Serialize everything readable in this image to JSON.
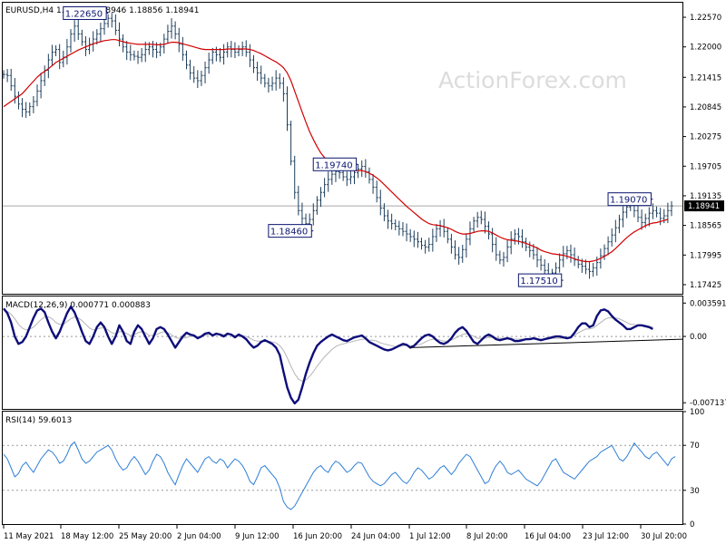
{
  "watermark": "ActionForex.com",
  "chart_data": [
    {
      "type": "line",
      "panel": "price",
      "title": "EURUSD,H4 1.18883 1.18946 1.18856 1.18941",
      "xlabel": "",
      "ylabel": "",
      "ylim": [
        1.1725,
        1.2285
      ],
      "y_ticks": [
        "1.22570",
        "1.22000",
        "1.21415",
        "1.20845",
        "1.20275",
        "1.19705",
        "1.19135",
        "1.18565",
        "1.17995",
        "1.17425"
      ],
      "current_price": "1.18941",
      "colors": {
        "price": "#1d3e5c",
        "ma": "#d20000",
        "current_line": "#a9a9a9"
      },
      "x_ticks": [
        "11 May 2021",
        "18 May 12:00",
        "25 May 20:00",
        "2 Jun 04:00",
        "9 Jun 12:00",
        "16 Jun 20:00",
        "24 Jun 04:00",
        "1 Jul 12:00",
        "8 Jul 20:00",
        "16 Jul 04:00",
        "23 Jul 12:00",
        "30 Jul 20:00"
      ],
      "annotations": [
        {
          "text": "1.22650",
          "x_index": 28,
          "y": 1.2265
        },
        {
          "text": "1.19740",
          "x_index": 95,
          "y": 1.1974
        },
        {
          "text": "1.18460",
          "x_index": 83,
          "y": 1.1846
        },
        {
          "text": "1.17510",
          "x_index": 150,
          "y": 1.1751
        },
        {
          "text": "1.19070",
          "x_index": 174,
          "y": 1.1907
        }
      ],
      "series": [
        {
          "name": "EURUSD",
          "values": [
            1.2147,
            1.2145,
            1.2125,
            1.2105,
            1.209,
            1.208,
            1.2075,
            1.2085,
            1.2095,
            1.2115,
            1.2135,
            1.2155,
            1.2175,
            1.219,
            1.2195,
            1.217,
            1.218,
            1.22,
            1.2225,
            1.224,
            1.2225,
            1.221,
            1.2195,
            1.2205,
            1.2215,
            1.2225,
            1.2235,
            1.2245,
            1.2255,
            1.225,
            1.2232,
            1.2215,
            1.22,
            1.219,
            1.2185,
            1.2182,
            1.218,
            1.2185,
            1.2195,
            1.22,
            1.2195,
            1.219,
            1.22,
            1.2215,
            1.223,
            1.224,
            1.2225,
            1.2205,
            1.2185,
            1.2165,
            1.215,
            1.214,
            1.2135,
            1.2145,
            1.216,
            1.2175,
            1.219,
            1.2185,
            1.218,
            1.219,
            1.22,
            1.2195,
            1.219,
            1.2195,
            1.22,
            1.219,
            1.2175,
            1.216,
            1.215,
            1.214,
            1.213,
            1.2125,
            1.213,
            1.214,
            1.213,
            1.211,
            1.205,
            1.198,
            1.192,
            1.1885,
            1.187,
            1.186,
            1.1868,
            1.1885,
            1.1905,
            1.192,
            1.1935,
            1.1945,
            1.1955,
            1.196,
            1.1958,
            1.195,
            1.1945,
            1.195,
            1.1958,
            1.1965,
            1.197,
            1.196,
            1.1945,
            1.193,
            1.191,
            1.189,
            1.1875,
            1.1865,
            1.186,
            1.1855,
            1.185,
            1.1845,
            1.184,
            1.1835,
            1.183,
            1.1825,
            1.1818,
            1.1815,
            1.182,
            1.1835,
            1.185,
            1.1855,
            1.1845,
            1.183,
            1.1815,
            1.18,
            1.1795,
            1.181,
            1.183,
            1.185,
            1.1865,
            1.1872,
            1.1868,
            1.1855,
            1.184,
            1.182,
            1.18,
            1.179,
            1.1795,
            1.1815,
            1.183,
            1.184,
            1.1835,
            1.1825,
            1.1815,
            1.1808,
            1.18,
            1.179,
            1.178,
            1.177,
            1.1762,
            1.1765,
            1.1775,
            1.179,
            1.1802,
            1.1808,
            1.18,
            1.179,
            1.1782,
            1.1778,
            1.1772,
            1.1768,
            1.1775,
            1.1785,
            1.1798,
            1.1812,
            1.1825,
            1.1838,
            1.1852,
            1.1868,
            1.1882,
            1.1892,
            1.1895,
            1.1885,
            1.1872,
            1.1862,
            1.187,
            1.188,
            1.1885,
            1.188,
            1.187,
            1.1875,
            1.1885,
            1.1894
          ]
        },
        {
          "name": "MA",
          "values": [
            1.2085,
            1.209,
            1.2095,
            1.21,
            1.2105,
            1.211,
            1.2118,
            1.2126,
            1.2134,
            1.2142,
            1.2148,
            1.2153,
            1.2158,
            1.2164,
            1.217,
            1.2174,
            1.2178,
            1.2182,
            1.2186,
            1.219,
            1.2194,
            1.2197,
            1.22,
            1.2203,
            1.2206,
            1.2208,
            1.221,
            1.2212,
            1.2213,
            1.2214,
            1.2214,
            1.2212,
            1.221,
            1.2208,
            1.2207,
            1.2206,
            1.2205,
            1.2205,
            1.2205,
            1.2205,
            1.2205,
            1.2204,
            1.2204,
            1.2205,
            1.2207,
            1.2209,
            1.2209,
            1.2208,
            1.2206,
            1.2204,
            1.2202,
            1.22,
            1.2198,
            1.2196,
            1.2195,
            1.2195,
            1.2195,
            1.2195,
            1.2195,
            1.2195,
            1.2196,
            1.2196,
            1.2196,
            1.2196,
            1.2196,
            1.2196,
            1.2195,
            1.2193,
            1.219,
            1.2187,
            1.2183,
            1.2179,
            1.2175,
            1.2171,
            1.2166,
            1.216,
            1.215,
            1.2135,
            1.2115,
            1.2095,
            1.2075,
            1.2055,
            1.2037,
            1.2022,
            1.2008,
            1.1996,
            1.1987,
            1.198,
            1.1975,
            1.1971,
            1.1968,
            1.1966,
            1.1964,
            1.1963,
            1.1962,
            1.1962,
            1.1962,
            1.196,
            1.1957,
            1.1953,
            1.1948,
            1.1942,
            1.1935,
            1.1928,
            1.1921,
            1.1914,
            1.1907,
            1.19,
            1.1893,
            1.1887,
            1.1881,
            1.1875,
            1.1869,
            1.1864,
            1.186,
            1.1858,
            1.1857,
            1.1856,
            1.1854,
            1.1852,
            1.1849,
            1.1845,
            1.1842,
            1.184,
            1.184,
            1.1841,
            1.1843,
            1.1845,
            1.1846,
            1.1846,
            1.1845,
            1.1842,
            1.1838,
            1.1834,
            1.1831,
            1.1829,
            1.1828,
            1.1827,
            1.1826,
            1.1824,
            1.1822,
            1.1819,
            1.1816,
            1.1813,
            1.1809,
            1.1806,
            1.1804,
            1.1802,
            1.1801,
            1.18,
            1.1799,
            1.1797,
            1.1795,
            1.1792,
            1.179,
            1.1788,
            1.1787,
            1.1787,
            1.1788,
            1.179,
            1.1793,
            1.1797,
            1.1801,
            1.1806,
            1.1812,
            1.1819,
            1.1826,
            1.1833,
            1.1839,
            1.1844,
            1.1848,
            1.1852,
            1.1856,
            1.1859,
            1.1861,
            1.1862,
            1.1864,
            1.1866,
            1.1868
          ]
        }
      ]
    },
    {
      "type": "line",
      "panel": "macd",
      "title": "MACD(12,26,9) 0.000771 0.000883",
      "ylim": [
        -0.0078,
        0.0043
      ],
      "y_ticks": [
        "0.003591",
        "0.00",
        "-0.007137"
      ],
      "y_tick_values": [
        0.003591,
        0.0,
        -0.007137
      ],
      "colors": {
        "macd": "#0d0d7a",
        "signal": "#b4b4b4",
        "trendline": "#000000"
      },
      "trendline": {
        "x_index": [
          109,
          184
        ],
        "y": [
          -0.0012,
          -0.0003
        ]
      },
      "series": [
        {
          "name": "MACD",
          "values": [
            0.003,
            0.0025,
            0.0015,
            0.0,
            -0.0008,
            -0.0006,
            0.0,
            0.001,
            0.002,
            0.0028,
            0.003,
            0.0026,
            0.0015,
            0.0005,
            -0.0002,
            0.0005,
            0.0015,
            0.0025,
            0.0032,
            0.0026,
            0.0016,
            0.0005,
            -0.0005,
            -0.0008,
            0.0,
            0.001,
            0.0015,
            0.001,
            0.0,
            -0.0008,
            0.0,
            0.0012,
            0.0005,
            -0.0005,
            -0.0008,
            0.0005,
            0.0012,
            0.0008,
            0.0,
            -0.0008,
            -0.0002,
            0.0008,
            0.001,
            0.0008,
            0.0002,
            -0.0005,
            -0.0012,
            -0.0006,
            0.0,
            0.0004,
            0.0002,
            0.0001,
            -0.0002,
            0.0,
            0.0003,
            0.0004,
            0.0001,
            0.0003,
            0.0002,
            0.0,
            0.0003,
            0.0002,
            -0.0001,
            0.0002,
            0.0,
            -0.0003,
            -0.0008,
            -0.0012,
            -0.001,
            -0.0006,
            -0.0004,
            -0.0006,
            -0.0008,
            -0.0012,
            -0.002,
            -0.0038,
            -0.0055,
            -0.0066,
            -0.0072,
            -0.0068,
            -0.0055,
            -0.004,
            -0.0028,
            -0.0018,
            -0.001,
            -0.0006,
            -0.0003,
            0.0,
            0.0002,
            0.0,
            -0.0002,
            -0.0004,
            -0.0005,
            -0.0003,
            -0.0001,
            0.0,
            0.0001,
            -0.0002,
            -0.0006,
            -0.0008,
            -0.001,
            -0.0012,
            -0.0014,
            -0.0015,
            -0.0014,
            -0.0012,
            -0.001,
            -0.0008,
            -0.0009,
            -0.0012,
            -0.001,
            -0.0006,
            -0.0002,
            0.0001,
            0.0002,
            0.0,
            -0.0004,
            -0.0007,
            -0.0008,
            -0.0006,
            -0.0002,
            0.0004,
            0.0008,
            0.001,
            0.0006,
            0.0,
            -0.0006,
            -0.0008,
            -0.0004,
            0.0,
            0.0002,
            0.0,
            -0.0003,
            -0.0004,
            -0.0003,
            -0.0002,
            -0.0003,
            -0.0005,
            -0.0005,
            -0.0004,
            -0.0003,
            -0.0003,
            -0.0002,
            -0.0003,
            -0.0004,
            -0.0003,
            -0.0002,
            -0.0001,
            0.0,
            0.0,
            -0.0001,
            -0.0002,
            -0.0001,
            0.0004,
            0.001,
            0.0014,
            0.0014,
            0.001,
            0.0012,
            0.0022,
            0.0028,
            0.0029,
            0.0027,
            0.0022,
            0.0018,
            0.0015,
            0.0012,
            0.0008,
            0.0008,
            0.001,
            0.0012,
            0.0012,
            0.0011,
            0.001,
            0.0008
          ]
        },
        {
          "name": "Signal",
          "values": [
            0.0028,
            0.0027,
            0.0024,
            0.0019,
            0.0013,
            0.0009,
            0.0007,
            0.0008,
            0.001,
            0.0014,
            0.0018,
            0.0021,
            0.0021,
            0.0019,
            0.0015,
            0.0013,
            0.0013,
            0.0016,
            0.0019,
            0.0021,
            0.002,
            0.0017,
            0.0013,
            0.0009,
            0.0007,
            0.0008,
            0.0009,
            0.0009,
            0.0007,
            0.0004,
            0.0003,
            0.0005,
            0.0005,
            0.0003,
            0.0001,
            0.0002,
            0.0004,
            0.0005,
            0.0004,
            0.0001,
            0.0001,
            0.0002,
            0.0004,
            0.0005,
            0.0004,
            0.0002,
            -0.0001,
            -0.0002,
            -0.0002,
            -0.0001,
            0.0,
            0.0,
            0.0,
            0.0,
            0.0001,
            0.0002,
            0.0002,
            0.0002,
            0.0002,
            0.0002,
            0.0002,
            0.0002,
            0.0001,
            0.0001,
            0.0001,
            0.0,
            -0.0002,
            -0.0004,
            -0.0005,
            -0.0005,
            -0.0005,
            -0.0005,
            -0.0006,
            -0.0007,
            -0.001,
            -0.0015,
            -0.0023,
            -0.0032,
            -0.004,
            -0.0046,
            -0.0048,
            -0.0047,
            -0.0043,
            -0.0038,
            -0.0032,
            -0.0027,
            -0.0022,
            -0.0018,
            -0.0014,
            -0.0011,
            -0.0009,
            -0.0008,
            -0.0007,
            -0.0006,
            -0.0005,
            -0.0004,
            -0.0003,
            -0.0003,
            -0.0004,
            -0.0004,
            -0.0005,
            -0.0007,
            -0.0008,
            -0.0009,
            -0.001,
            -0.0011,
            -0.0011,
            -0.001,
            -0.001,
            -0.001,
            -0.001,
            -0.0009,
            -0.0008,
            -0.0006,
            -0.0004,
            -0.0003,
            -0.0003,
            -0.0004,
            -0.0005,
            -0.0005,
            -0.0004,
            -0.0002,
            0.0,
            0.0002,
            0.0003,
            0.0002,
            0.0,
            -0.0002,
            -0.0002,
            -0.0002,
            -0.0001,
            -0.0001,
            -0.0001,
            -0.0002,
            -0.0002,
            -0.0002,
            -0.0002,
            -0.0003,
            -0.0003,
            -0.0003,
            -0.0003,
            -0.0003,
            -0.0003,
            -0.0003,
            -0.0003,
            -0.0003,
            -0.0003,
            -0.0002,
            -0.0002,
            -0.0002,
            -0.0002,
            -0.0002,
            -0.0001,
            0.0001,
            0.0004,
            0.0006,
            0.0008,
            0.0008,
            0.0009,
            0.0012,
            0.0015,
            0.0018,
            0.002,
            0.002,
            0.002,
            0.0019,
            0.0017,
            0.0015,
            0.0013,
            0.0013,
            0.0012,
            0.0012,
            0.0012,
            0.0011,
            0.001
          ]
        }
      ]
    },
    {
      "type": "line",
      "panel": "rsi",
      "title": "RSI(14) 59.6013",
      "ylim": [
        0,
        100
      ],
      "y_ticks": [
        "100",
        "70",
        "30",
        "0"
      ],
      "y_tick_values": [
        100,
        70,
        30,
        0
      ],
      "colors": {
        "rsi": "#2f7fd8",
        "levels": "#9a9a9a"
      },
      "series": [
        {
          "name": "RSI",
          "values": [
            62,
            58,
            50,
            42,
            45,
            52,
            55,
            50,
            46,
            52,
            58,
            62,
            66,
            64,
            60,
            54,
            56,
            62,
            70,
            73,
            66,
            58,
            54,
            56,
            60,
            64,
            66,
            68,
            70,
            66,
            58,
            52,
            48,
            50,
            56,
            60,
            56,
            50,
            44,
            48,
            56,
            62,
            60,
            54,
            46,
            40,
            35,
            44,
            52,
            58,
            54,
            50,
            46,
            52,
            58,
            60,
            56,
            54,
            58,
            56,
            50,
            54,
            58,
            56,
            52,
            46,
            38,
            35,
            42,
            50,
            52,
            48,
            44,
            40,
            32,
            20,
            15,
            13,
            16,
            22,
            28,
            34,
            40,
            46,
            50,
            52,
            48,
            46,
            52,
            56,
            54,
            50,
            46,
            48,
            52,
            55,
            54,
            48,
            42,
            38,
            36,
            34,
            36,
            40,
            44,
            46,
            42,
            38,
            36,
            40,
            46,
            50,
            48,
            44,
            40,
            42,
            46,
            50,
            52,
            48,
            44,
            48,
            54,
            58,
            62,
            60,
            54,
            48,
            42,
            36,
            38,
            46,
            52,
            56,
            52,
            46,
            44,
            46,
            48,
            44,
            40,
            38,
            36,
            34,
            38,
            44,
            50,
            56,
            58,
            52,
            46,
            44,
            42,
            40,
            44,
            48,
            52,
            56,
            58,
            60,
            64,
            66,
            68,
            70,
            64,
            58,
            56,
            60,
            66,
            72,
            68,
            64,
            60,
            58,
            62,
            64,
            60,
            56,
            52,
            58,
            60
          ]
        }
      ]
    }
  ]
}
